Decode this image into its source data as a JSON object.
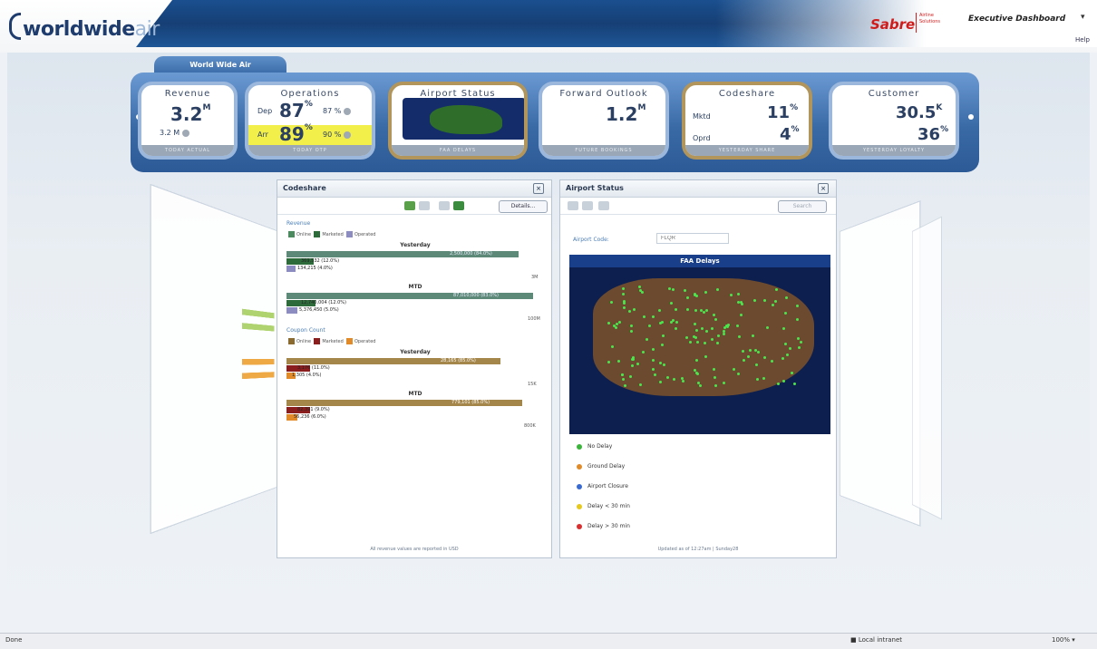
{
  "header": {
    "logo_main": "worldwide",
    "logo_accent": "air",
    "brand": "Sabre",
    "brand_sub": "Airline Solutions",
    "dashboard": "Executive Dashboard",
    "help": "Help"
  },
  "kpi": {
    "tab_label": "World Wide Air",
    "cards": {
      "revenue": {
        "title": "Revenue",
        "value": "3.2",
        "unit": "M",
        "sub": "3.2 M",
        "footer": "TODAY ACTUAL"
      },
      "operations": {
        "title": "Operations",
        "dep_label": "Dep",
        "dep_value": "87",
        "dep_sub": "87 %",
        "arr_label": "Arr",
        "arr_value": "89",
        "arr_sub": "90 %",
        "unit": "%",
        "footer": "TODAY OTP"
      },
      "airport": {
        "title": "Airport Status",
        "footer": "FAA DELAYS"
      },
      "forward": {
        "title": "Forward Outlook",
        "value": "1.2",
        "unit": "M",
        "footer": "FUTURE BOOKINGS"
      },
      "codeshare": {
        "title": "Codeshare",
        "r1_label": "Mktd",
        "r1_value": "11",
        "r2_label": "Oprd",
        "r2_value": "4",
        "unit": "%",
        "footer": "YESTERDAY SHARE"
      },
      "customer": {
        "title": "Customer",
        "r1_value": "30.5",
        "r1_unit": "K",
        "r2_value": "36",
        "r2_unit": "%",
        "footer": "YESTERDAY LOYALTY"
      }
    }
  },
  "codeshare": {
    "title": "Codeshare",
    "details_btn": "Details...",
    "section_revenue": "Revenue",
    "legend": [
      "Online",
      "Marketed",
      "Operated"
    ],
    "legend_colors_rev": [
      "#4a8a5e",
      "#2e6b3b",
      "#8c8cc0"
    ],
    "chart1_title": "Yesterday",
    "chart1_top": "2,500,000 (84.0%)",
    "chart1_mid": "369,532 (12.0%)",
    "chart1_low": "134,215 (4.0%)",
    "chart1_axis": "3M",
    "chart2_title": "MTD",
    "chart2_top": "87,010,000 (83.0%)",
    "chart2_mid": "12,740,004 (12.0%)",
    "chart2_low": "5,376,450 (5.0%)",
    "chart2_axis": "100M",
    "section_pax": "Coupon Count",
    "legend_colors_pax": [
      "#8a6a2e",
      "#8a1e1e",
      "#e08a2a"
    ],
    "chart3_title": "Yesterday",
    "chart3_top": "28,165 (85.0%)",
    "chart3_mid": "3,176 (11.0%)",
    "chart3_low": "1,305 (4.0%)",
    "chart3_axis": "15K",
    "chart4_title": "MTD",
    "chart4_top": "779,101 (85.0%)",
    "chart4_mid": "82,391 (9.0%)",
    "chart4_low": "56,236 (6.0%)",
    "chart4_axis": "800K",
    "footer": "All revenue values are reported in USD"
  },
  "airport_status": {
    "title": "Airport Status",
    "search_btn": "Search",
    "code_label": "Airport Code:",
    "code_placeholder": "FLQR",
    "map_title": "FAA Delays",
    "legend": [
      {
        "label": "No Delay",
        "color": "#3cb43c"
      },
      {
        "label": "Ground Delay",
        "color": "#e08a2a"
      },
      {
        "label": "Airport Closure",
        "color": "#3a6ad0"
      },
      {
        "label": "Delay < 30 min",
        "color": "#e6c81e"
      },
      {
        "label": "Delay > 30 min",
        "color": "#d83030"
      }
    ],
    "footer": "Updated as of 12:27am | Sunday28"
  },
  "statusbar": {
    "left": "Done",
    "zone": "Local intranet",
    "zoom": "100%"
  }
}
